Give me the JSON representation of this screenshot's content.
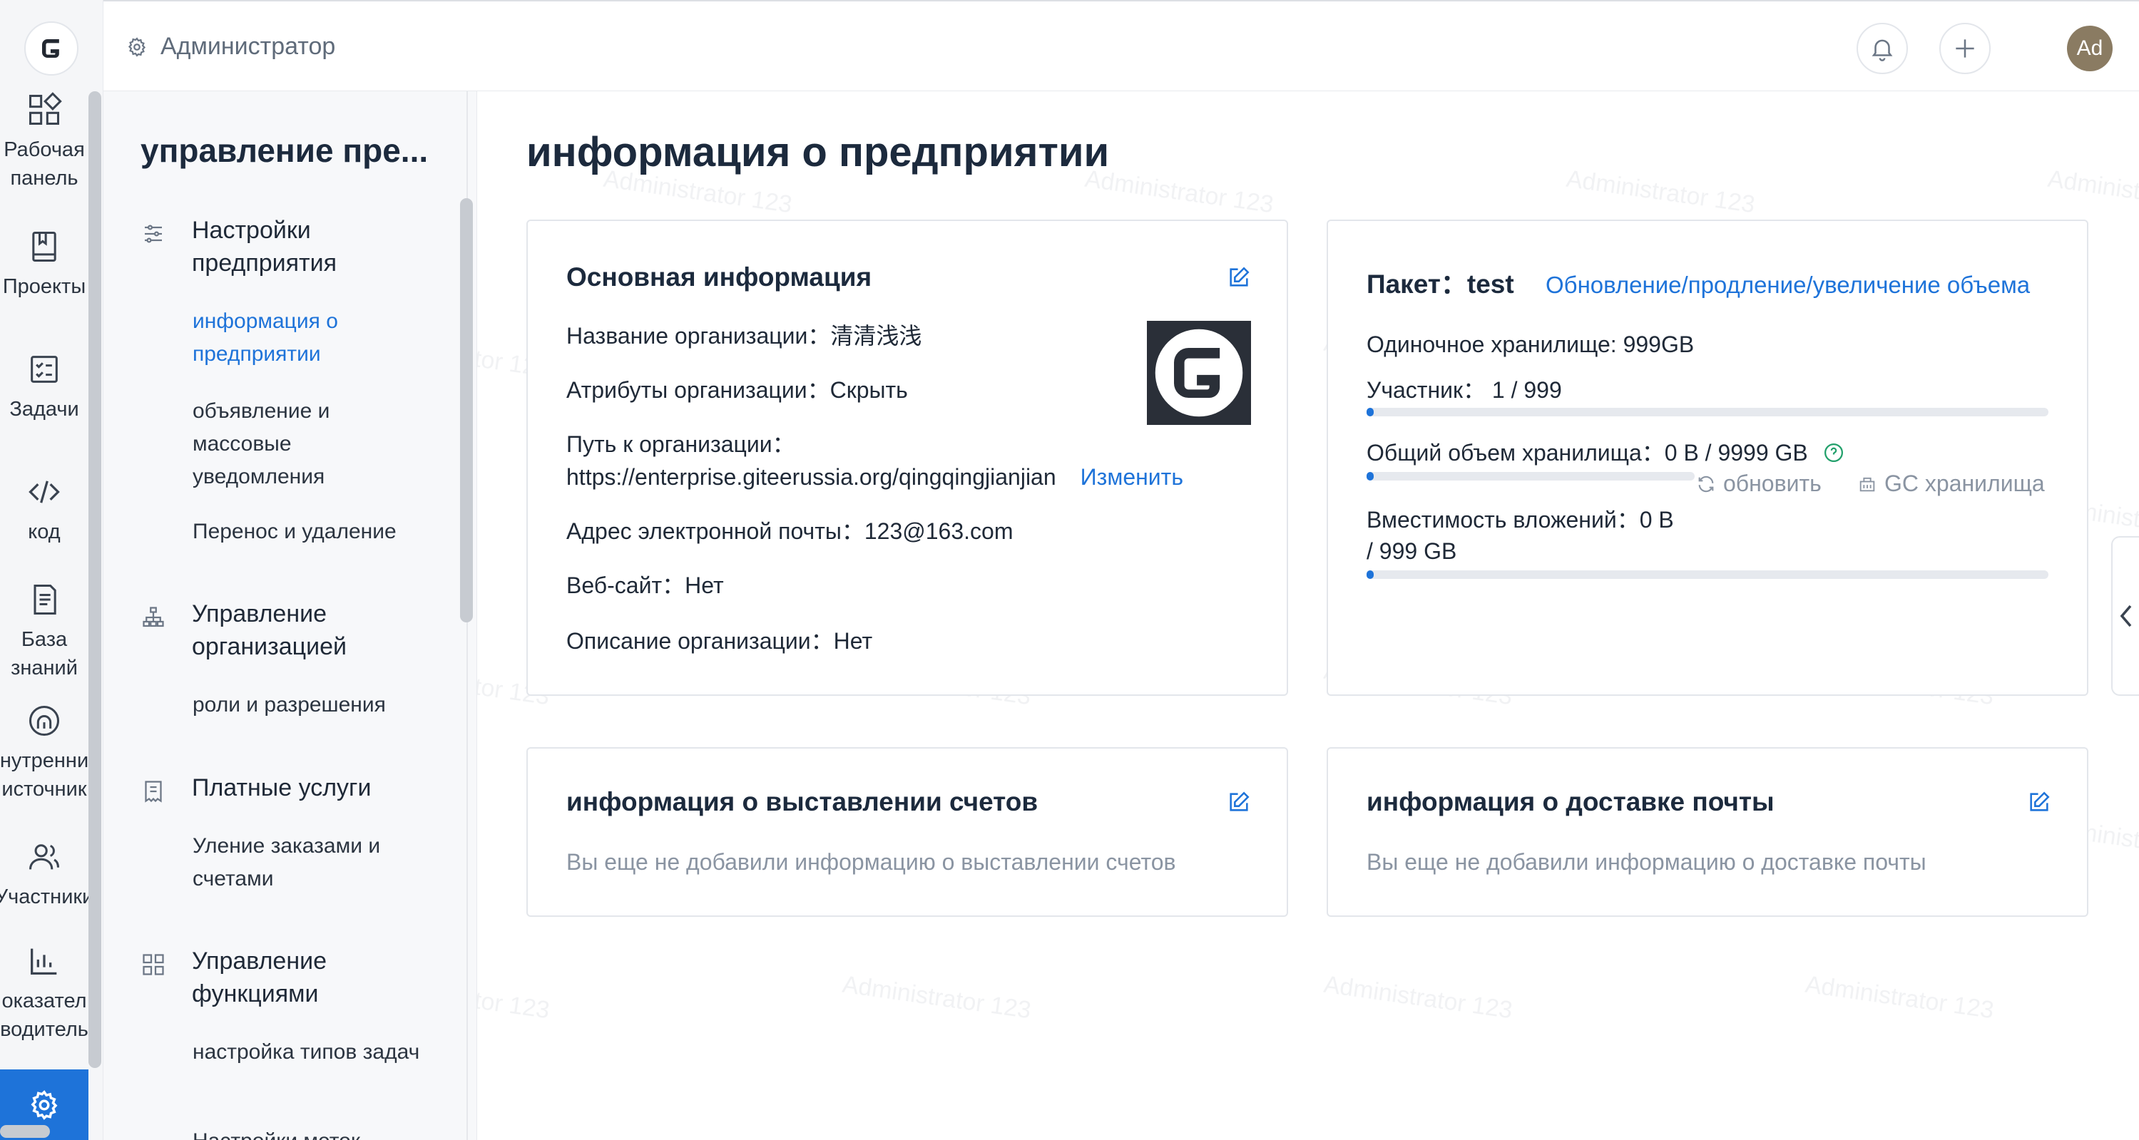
{
  "rail": {
    "items": [
      {
        "label_1": "Рабочая",
        "label_2": "панель",
        "icon": "dashboard-icon"
      },
      {
        "label_1": "Проекты",
        "icon": "book-icon"
      },
      {
        "label_1": "Задачи",
        "icon": "tasks-icon"
      },
      {
        "label_1": "код",
        "icon": "code-icon"
      },
      {
        "label_1": "База",
        "label_2": "знаний",
        "icon": "document-icon"
      },
      {
        "label_1": "нутренни",
        "label_2": "источник",
        "icon": "source-icon"
      },
      {
        "label_1": "Участники",
        "icon": "users-icon"
      },
      {
        "label_1": "оказател",
        "label_2": "водитель",
        "icon": "chart-icon"
      }
    ]
  },
  "sidebar": {
    "title": "управление пре...",
    "groups": [
      {
        "label": "Настройки предприятия",
        "icon": "sliders-icon"
      },
      {
        "label": "Управление организацией",
        "icon": "org-icon"
      },
      {
        "label": "Платные услуги",
        "icon": "invoice-icon"
      },
      {
        "label": "Управление функциями",
        "icon": "grid-icon"
      }
    ],
    "subs": [
      "информация о предприятии",
      "объявление и массовые уведомления",
      "Перенос и удаление",
      "роли и разрешения",
      "Уление заказами и счетами",
      "настройка типов задач",
      "Настройки меток"
    ]
  },
  "header": {
    "breadcrumb": "Администратор",
    "avatar": "Ad"
  },
  "main": {
    "title": "информация о предприятии",
    "basic": {
      "title": "Основная информация",
      "name_label": "Название организации：",
      "name_value": "清清浅浅",
      "attr_label": "Атрибуты организации：",
      "attr_value": "Скрыть",
      "path_label": "Путь к организации：",
      "path_value": "https://enterprise.giteerussia.org/qingqingjianjian",
      "path_action": "Изменить",
      "email_label": "Адрес электронной почты：",
      "email_value": "123@163.com",
      "site_label": "Веб-сайт：",
      "site_value": "Нет",
      "desc_label": "Описание организации：",
      "desc_value": "Нет"
    },
    "package": {
      "label": "Пакет：",
      "name": "test",
      "upgrade_link": "Обновление/продление/увеличение объема",
      "single_storage": "Одиночное хранилище: 999GB",
      "members": "Участник：  1 / 999",
      "members_ratio": 0.001,
      "total_storage": "Общий объем хранилища：0 B / 9999 GB",
      "total_ratio": 0.004,
      "refresh": "обновить",
      "gc": "GC хранилища",
      "attach_1": "Вместимость вложений：0 B",
      "attach_2": "/ 999 GB",
      "attach_ratio": 0.004
    },
    "billing": {
      "title": "информация о выставлении счетов",
      "empty": "Вы еще не добавили информацию о выставлении счетов"
    },
    "mail": {
      "title": "информация о доставке почты",
      "empty": "Вы еще не добавили информацию о доставке почты"
    }
  },
  "watermark": "Administrator 123",
  "colors": {
    "accent": "#1e73d9",
    "text": "#1c2a3d",
    "muted": "#8a94a2"
  }
}
